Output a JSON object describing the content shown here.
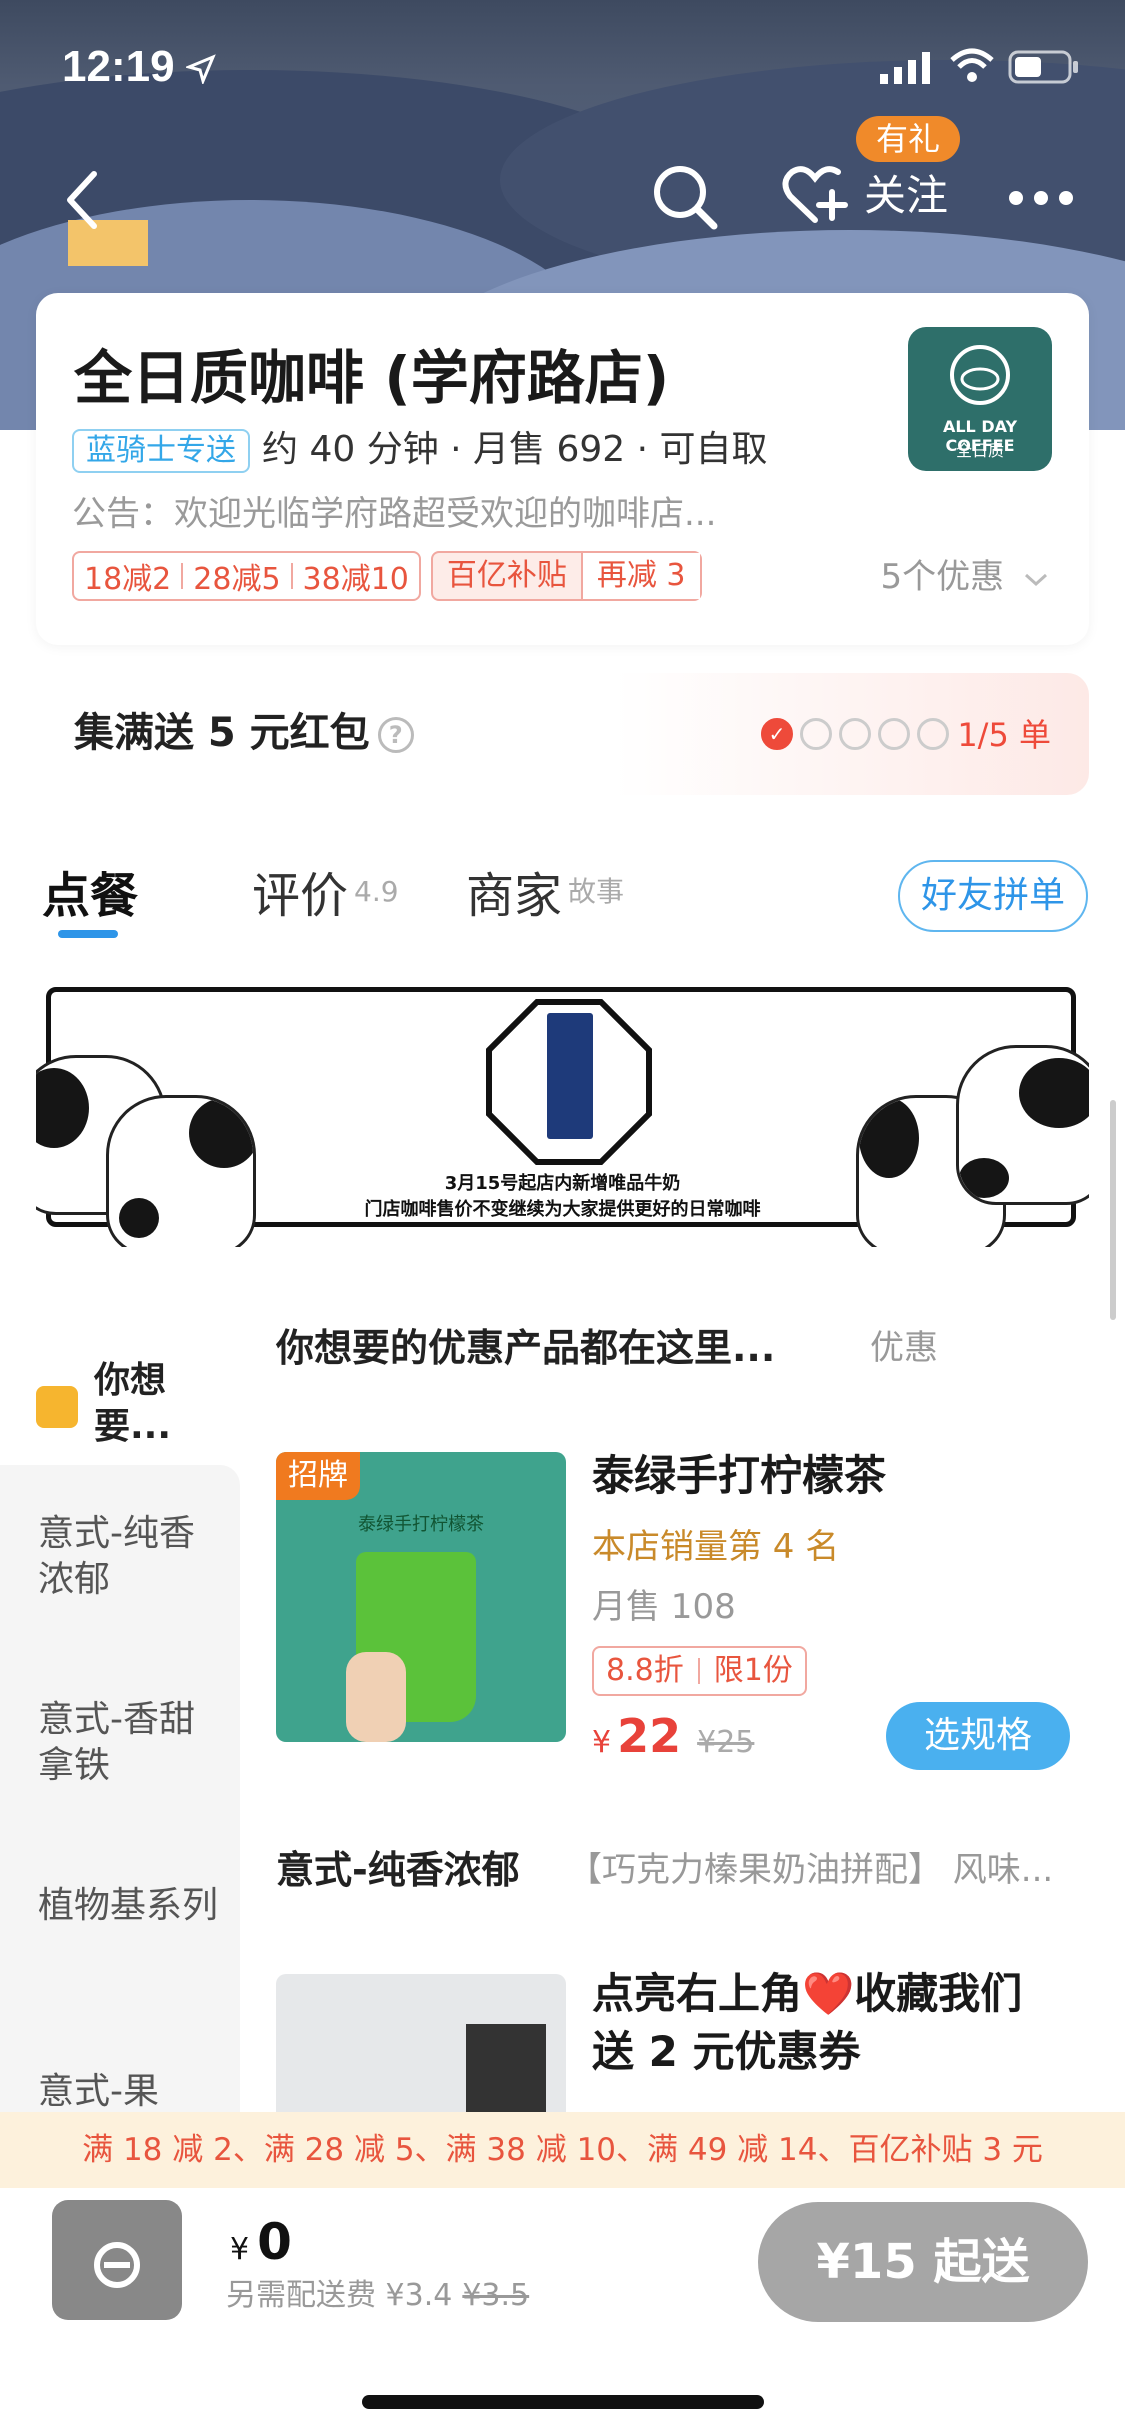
{
  "status_bar": {
    "time": "12:19"
  },
  "header": {
    "gift_badge": "有礼",
    "follow_label": "关注",
    "icons": [
      "back-icon",
      "search-icon",
      "heart-plus-icon",
      "more-icon",
      "location-arrow-icon",
      "signal-icon",
      "wifi-icon",
      "battery-icon"
    ]
  },
  "store": {
    "name": "全日质咖啡 (学府路店)",
    "delivery_tag": "蓝骑士专送",
    "meta": "约 40 分钟 · 月售 692 · 可自取",
    "notice": "公告：欢迎光临学府路超受欢迎的咖啡店...",
    "logo_text_en": "ALL DAY COFFEE",
    "logo_text_cn": "全日质",
    "promos": [
      "18减2",
      "28减5",
      "38减10"
    ],
    "subsidy": {
      "label": "百亿补贴",
      "value": "再减 3"
    },
    "offers_count": "5个优惠"
  },
  "reward": {
    "title": "集满送 5 元红包",
    "progress_done": 1,
    "progress_total": 5,
    "progress_label": "1/5 单"
  },
  "tabs": {
    "order": "点餐",
    "reviews": "评价",
    "reviews_score": "4.9",
    "merchant": "商家",
    "merchant_sup": "故事",
    "group_button": "好友拼单"
  },
  "banner": {
    "line1": "3月15号起店内新增唯品牛奶",
    "line2": "门店咖啡售价不变继续为大家提供更好的日常咖啡"
  },
  "sidebar": {
    "top": "你想要...",
    "items": [
      "意式-纯香浓郁",
      "意式-香甜拿铁",
      "植物基系列",
      "意式-果"
    ]
  },
  "section1": {
    "title": "你想要的优惠产品都在这里...",
    "sub": "优惠"
  },
  "product1": {
    "badge": "招牌",
    "image_caption": "泰绿手打柠檬茶",
    "name": "泰绿手打柠檬茶",
    "rank": "本店销量第 4 名",
    "sold": "月售 108",
    "discount": "8.8折",
    "limit": "限1份",
    "currency": "¥",
    "price": "22",
    "old_price": "¥25",
    "button": "选规格"
  },
  "section2": {
    "title": "意式-纯香浓郁",
    "sub": "【巧克力榛果奶油拼配】 风味..."
  },
  "product2": {
    "name_line1": "点亮右上角❤️收藏我们",
    "name_line2": "送 2 元优惠券"
  },
  "promo_strip": "满 18 减 2、满 28 减 5、满 38 减 10、满 49 减 14、百亿补贴 3 元",
  "footer": {
    "currency": "¥",
    "total": "0",
    "fee_label": "另需配送费 ¥3.4",
    "fee_old": "¥3.5",
    "order_button": "¥15 起送"
  }
}
